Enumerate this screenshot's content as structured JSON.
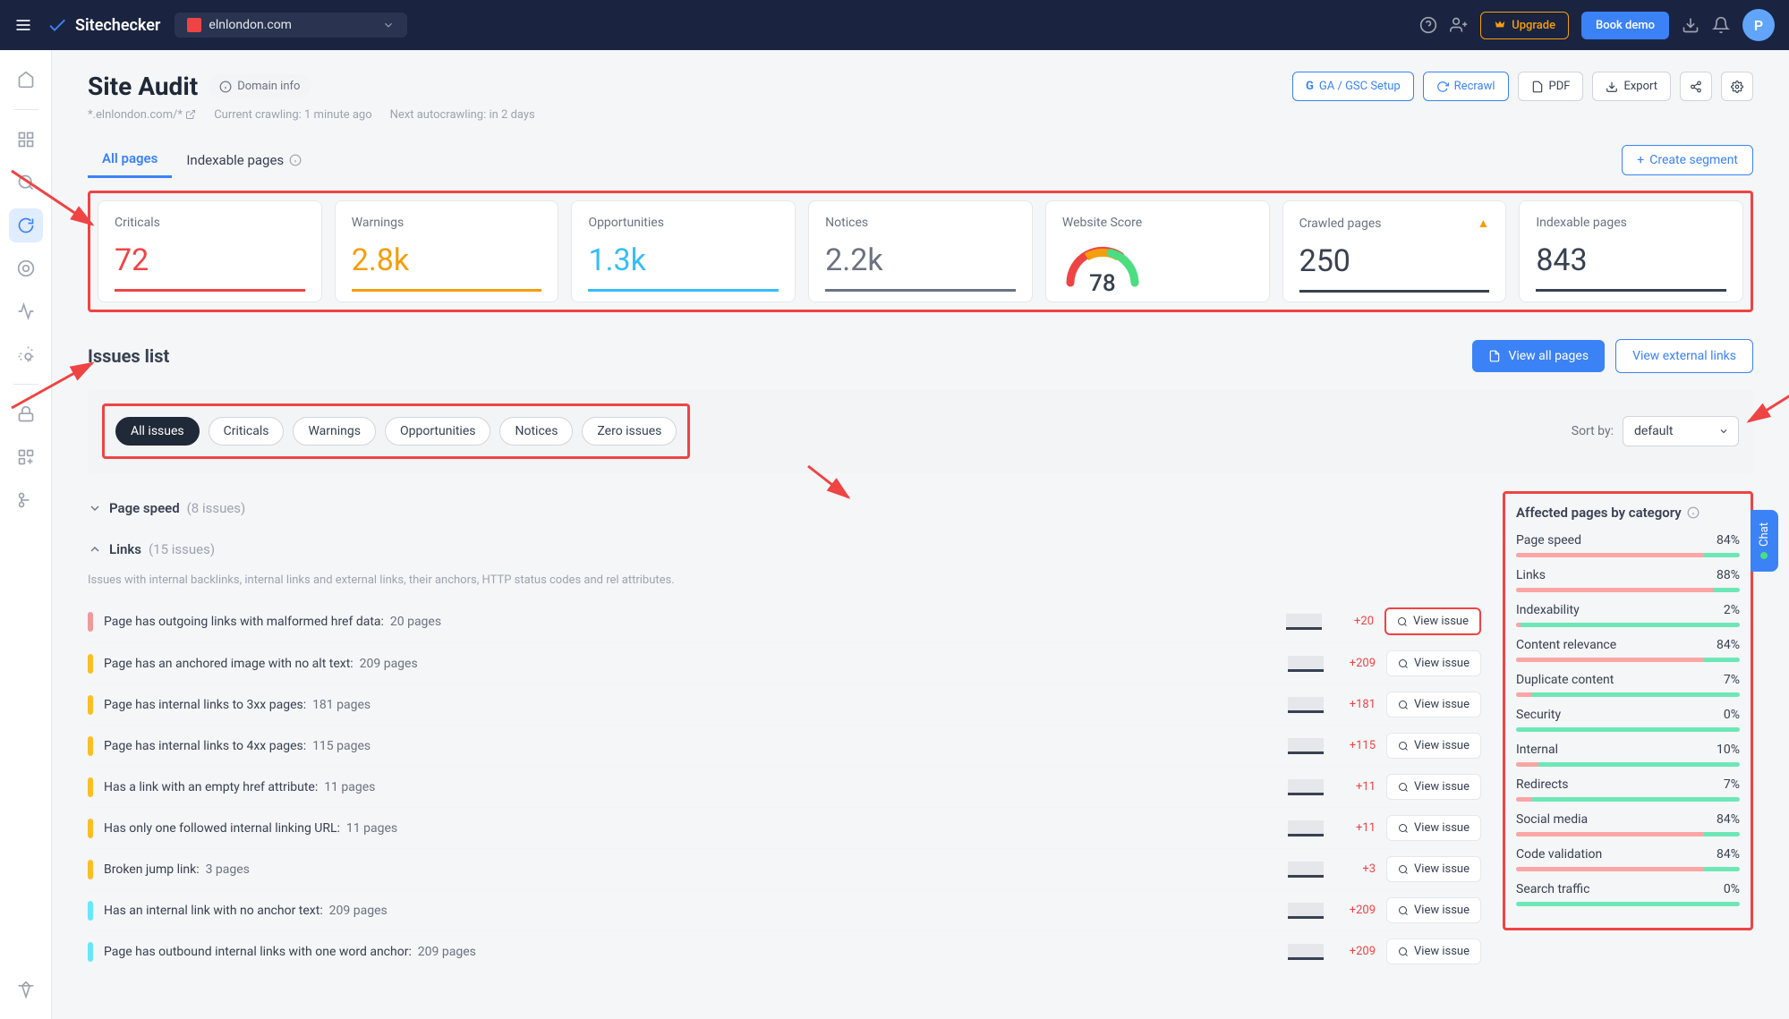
{
  "header": {
    "brand": "Sitechecker",
    "domain": "elnlondon.com",
    "upgrade": "Upgrade",
    "book_demo": "Book demo",
    "avatar_letter": "P"
  },
  "page": {
    "title": "Site Audit",
    "domain_info": "Domain info",
    "domain_pattern": "*.elnlondon.com/*",
    "crawl_status": "Current crawling: 1 minute ago",
    "next_crawl": "Next autocrawling: in 2 days"
  },
  "actions": {
    "ga": "GA / GSC Setup",
    "recrawl": "Recrawl",
    "pdf": "PDF",
    "export": "Export",
    "create_segment": "Create segment"
  },
  "tabs": {
    "all_pages": "All pages",
    "indexable": "Indexable pages"
  },
  "stats": {
    "criticals": {
      "label": "Criticals",
      "value": "72"
    },
    "warnings": {
      "label": "Warnings",
      "value": "2.8k"
    },
    "opportunities": {
      "label": "Opportunities",
      "value": "1.3k"
    },
    "notices": {
      "label": "Notices",
      "value": "2.2k"
    },
    "score": {
      "label": "Website Score",
      "value": "78"
    },
    "crawled": {
      "label": "Crawled pages",
      "value": "250"
    },
    "indexable": {
      "label": "Indexable pages",
      "value": "843"
    }
  },
  "issues": {
    "title": "Issues list",
    "view_all": "View all pages",
    "view_external": "View external links",
    "sort_label": "Sort by:",
    "sort_value": "default",
    "chips": [
      "All issues",
      "Criticals",
      "Warnings",
      "Opportunities",
      "Notices",
      "Zero issues"
    ],
    "groups": [
      {
        "title": "Page speed",
        "count": "(8 issues)",
        "expanded": false
      },
      {
        "title": "Links",
        "count": "(15 issues)",
        "expanded": true,
        "desc": "Issues with internal backlinks, internal links and external links, their anchors, HTTP status codes and rel attributes.",
        "items": [
          {
            "sev": "red",
            "text": "Page has outgoing links with malformed href data:",
            "pages": "20 pages",
            "delta": "+20",
            "hl": true
          },
          {
            "sev": "orange",
            "text": "Page has an anchored image with no alt text:",
            "pages": "209 pages",
            "delta": "+209"
          },
          {
            "sev": "orange",
            "text": "Page has internal links to 3xx pages:",
            "pages": "181 pages",
            "delta": "+181"
          },
          {
            "sev": "orange",
            "text": "Page has internal links to 4xx pages:",
            "pages": "115 pages",
            "delta": "+115"
          },
          {
            "sev": "orange",
            "text": "Has a link with an empty href attribute:",
            "pages": "11 pages",
            "delta": "+11"
          },
          {
            "sev": "orange",
            "text": "Has only one followed internal linking URL:",
            "pages": "11 pages",
            "delta": "+11"
          },
          {
            "sev": "orange",
            "text": "Broken jump link:",
            "pages": "3 pages",
            "delta": "+3"
          },
          {
            "sev": "opp",
            "text": "Has an internal link with no anchor text:",
            "pages": "209 pages",
            "delta": "+209"
          },
          {
            "sev": "opp",
            "text": "Page has outbound internal links with one word anchor:",
            "pages": "209 pages",
            "delta": "+209"
          }
        ]
      }
    ],
    "view_issue": "View issue"
  },
  "categories": {
    "title": "Affected pages by category",
    "items": [
      {
        "name": "Page speed",
        "pct": "84%"
      },
      {
        "name": "Links",
        "pct": "88%"
      },
      {
        "name": "Indexability",
        "pct": "2%"
      },
      {
        "name": "Content relevance",
        "pct": "84%"
      },
      {
        "name": "Duplicate content",
        "pct": "7%"
      },
      {
        "name": "Security",
        "pct": "0%"
      },
      {
        "name": "Internal",
        "pct": "10%"
      },
      {
        "name": "Redirects",
        "pct": "7%"
      },
      {
        "name": "Social media",
        "pct": "84%"
      },
      {
        "name": "Code validation",
        "pct": "84%"
      },
      {
        "name": "Search traffic",
        "pct": "0%"
      }
    ]
  },
  "chat": "Chat"
}
